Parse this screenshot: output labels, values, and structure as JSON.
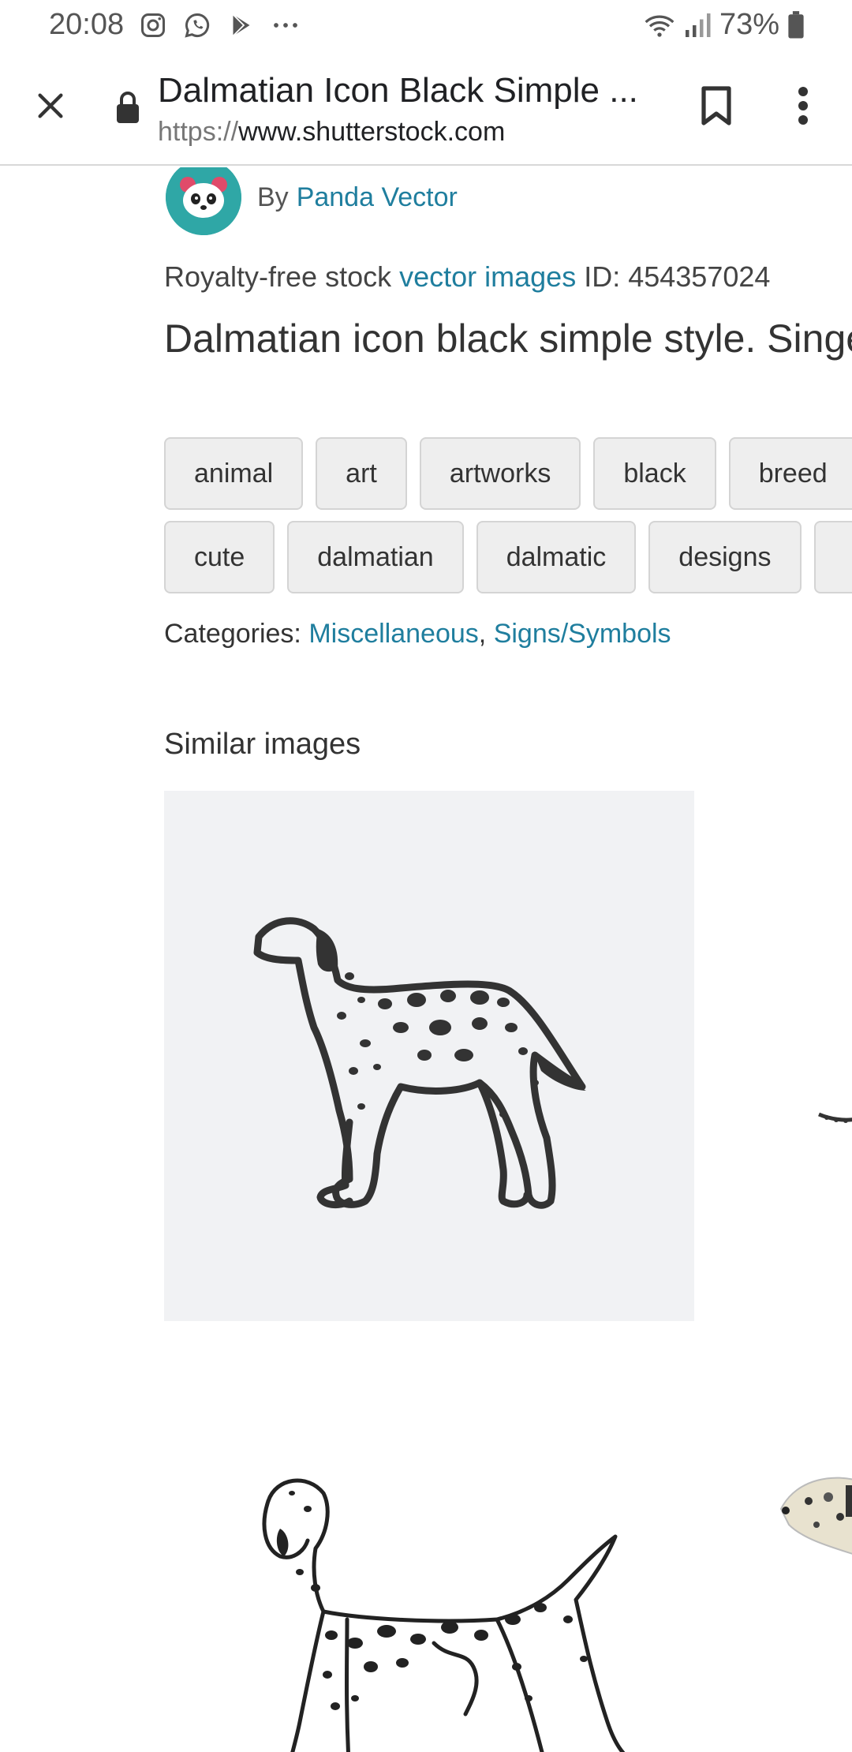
{
  "status_bar": {
    "time": "20:08",
    "battery": "73%",
    "icons": [
      "instagram-icon",
      "whatsapp-icon",
      "play-store-icon",
      "more-notifications-icon",
      "wifi-icon",
      "signal-icon",
      "battery-icon"
    ]
  },
  "toolbar": {
    "title": "Dalmatian Icon Black Simple ...",
    "url_scheme": "https://",
    "url_host": "www.shutterstock.com"
  },
  "author": {
    "by_label": "By",
    "name": "Panda Vector"
  },
  "meta": {
    "prefix": "Royalty-free stock",
    "link": "vector images",
    "id_label": "ID: 454357024"
  },
  "image_title": "Dalmatian icon black simple style. Singe do",
  "tags": {
    "row1": [
      "animal",
      "art",
      "artworks",
      "black",
      "breed"
    ],
    "row2": [
      "cute",
      "dalmatian",
      "dalmatic",
      "designs",
      ""
    ]
  },
  "categories": {
    "label": "Categories:",
    "items": [
      "Miscellaneous",
      "Signs/Symbols"
    ],
    "separator": ","
  },
  "similar": {
    "heading": "Similar images"
  }
}
